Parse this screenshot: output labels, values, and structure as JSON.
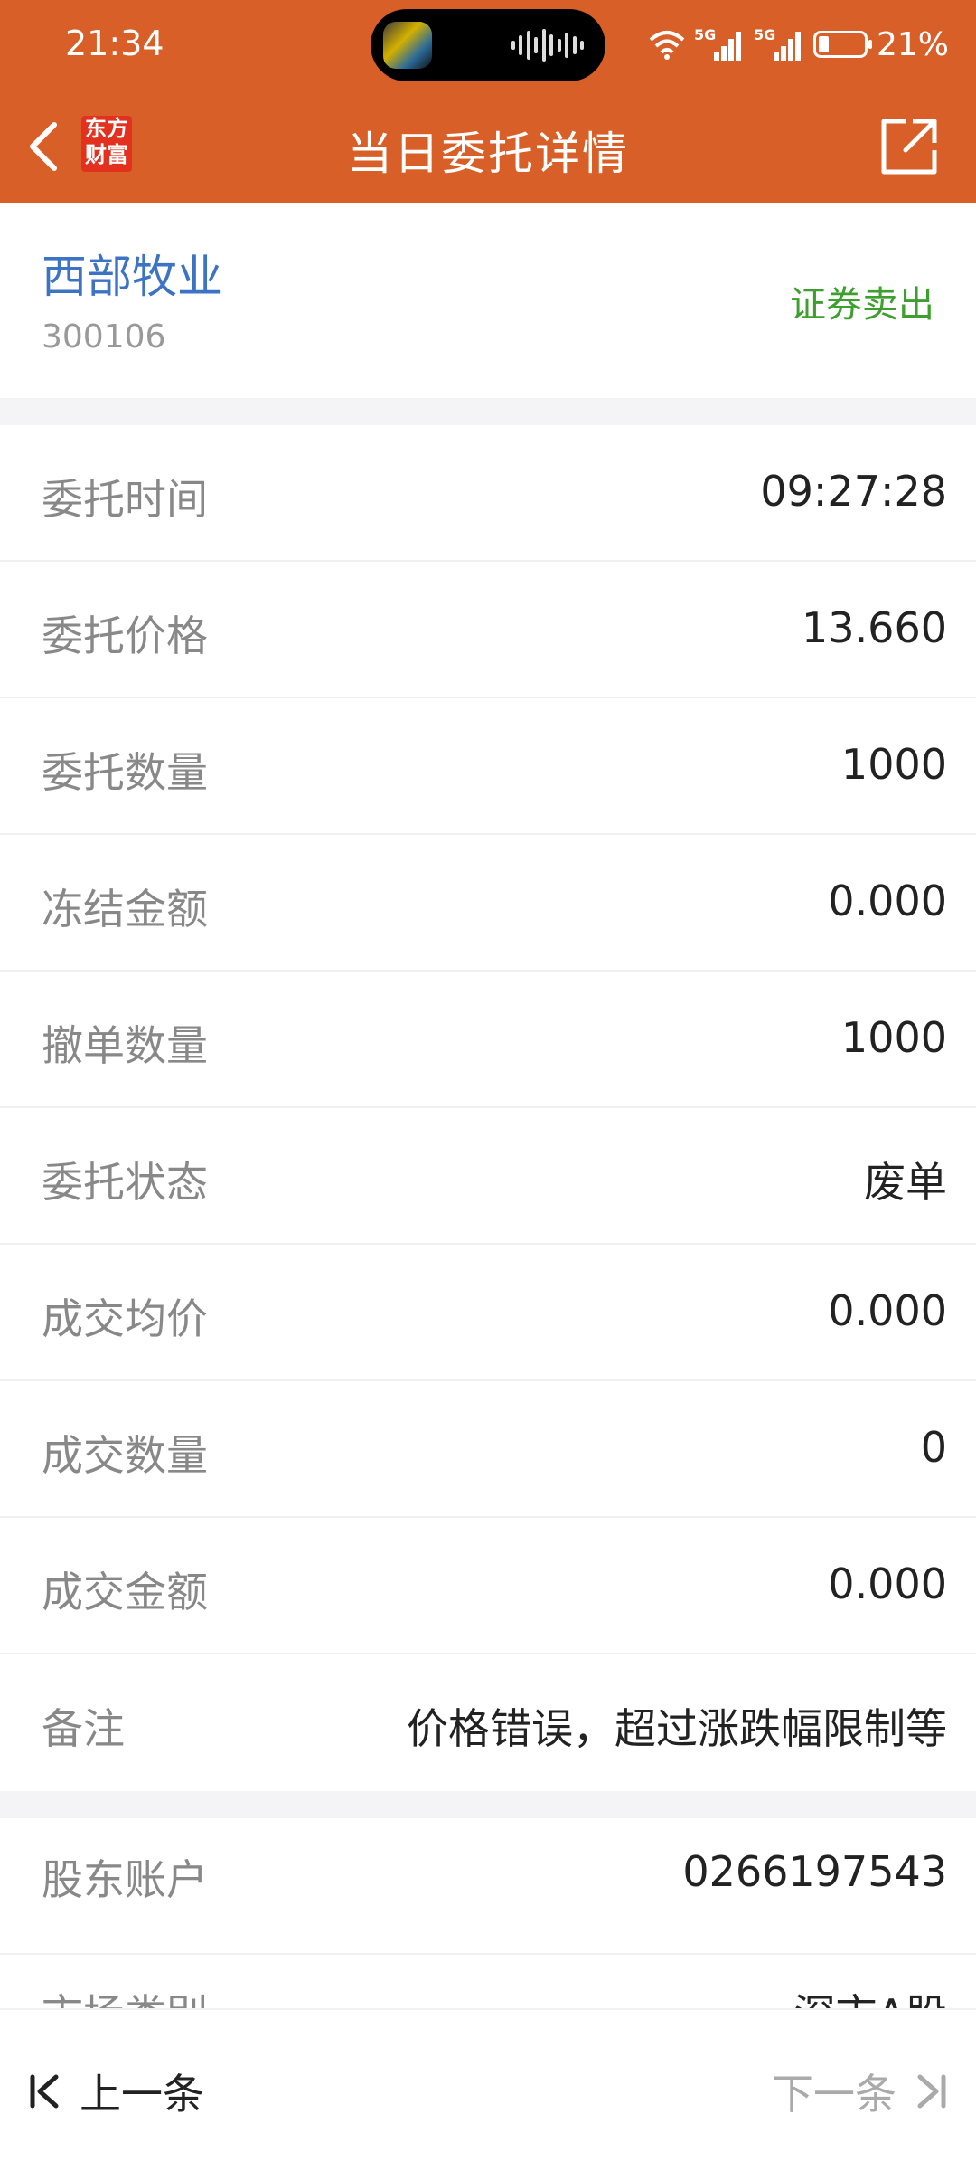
{
  "status_bar": {
    "time": "21:34",
    "battery": "21%",
    "network_1": "5G",
    "network_2": "5G"
  },
  "header": {
    "title": "当日委托详情",
    "logo_line1": "东方",
    "logo_line2": "财富"
  },
  "stock": {
    "name": "西部牧业",
    "code": "300106",
    "trade_type": "证券卖出"
  },
  "details": [
    {
      "label": "委托时间",
      "value": "09:27:28"
    },
    {
      "label": "委托价格",
      "value": "13.660"
    },
    {
      "label": "委托数量",
      "value": "1000"
    },
    {
      "label": "冻结金额",
      "value": "0.000"
    },
    {
      "label": "撤单数量",
      "value": "1000"
    },
    {
      "label": "委托状态",
      "value": "废单"
    },
    {
      "label": "成交均价",
      "value": "0.000"
    },
    {
      "label": "成交数量",
      "value": "0"
    },
    {
      "label": "成交金额",
      "value": "0.000"
    },
    {
      "label": "备注",
      "value": "价格错误，超过涨跌幅限制等"
    }
  ],
  "account": [
    {
      "label": "股东账户",
      "value": "0266197543"
    },
    {
      "label": "市场类别",
      "value": "深市A股"
    }
  ],
  "bottom": {
    "prev_label": "上一条",
    "next_label": "下一条"
  },
  "colors": {
    "header_bg": "#d95f28",
    "stock_name": "#3d73c4",
    "trade_type": "#3d9f2e"
  }
}
